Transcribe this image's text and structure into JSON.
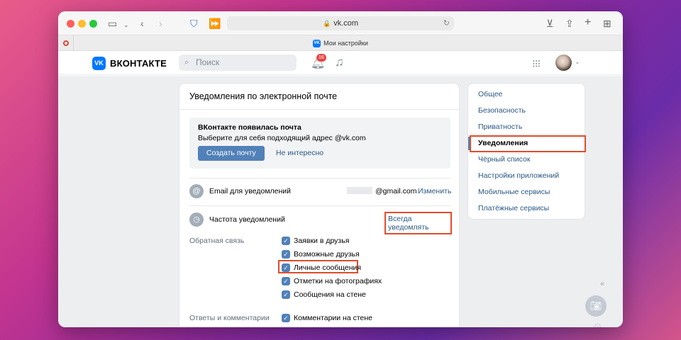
{
  "browser": {
    "url": "vk.com",
    "tab_title": "Мои настройки"
  },
  "header": {
    "logo_text": "ВКОНТАКТЕ",
    "search_placeholder": "Поиск",
    "notifications_count": "16"
  },
  "main": {
    "title": "Уведомления по электронной почте",
    "promo": {
      "title": "ВКонтакте появилась почта",
      "subtitle": "Выберите для себя подходящий адрес @vk.com",
      "create_button": "Создать почту",
      "dismiss_link": "Не интересно"
    },
    "email_row": {
      "label": "Email для уведомлений",
      "value": "@gmail.com",
      "separator": "·",
      "change_link": "Изменить"
    },
    "frequency_row": {
      "label": "Частота уведомлений",
      "value": "Всегда уведомлять"
    },
    "feedback": {
      "label": "Обратная связь",
      "options": [
        {
          "label": "Заявки в друзья",
          "checked": true
        },
        {
          "label": "Возможные друзья",
          "checked": true
        },
        {
          "label": "Личные сообщения",
          "checked": true
        },
        {
          "label": "Отметки на фотографиях",
          "checked": true
        },
        {
          "label": "Сообщения на стене",
          "checked": true
        }
      ]
    },
    "replies": {
      "label": "Ответы и комментарии",
      "options": [
        {
          "label": "Комментарии на стене",
          "checked": true
        }
      ]
    }
  },
  "sidebar": {
    "items": [
      {
        "label": "Общее"
      },
      {
        "label": "Безопасность"
      },
      {
        "label": "Приватность"
      },
      {
        "label": "Уведомления",
        "active": true
      },
      {
        "label": "Чёрный список"
      },
      {
        "label": "Настройки приложений"
      },
      {
        "label": "Мобильные сервисы"
      },
      {
        "label": "Платёжные сервисы"
      }
    ]
  },
  "colors": {
    "accent": "#5181b8",
    "link": "#2a5885",
    "highlight": "#e24c2b",
    "vk_brand": "#0077ff"
  }
}
